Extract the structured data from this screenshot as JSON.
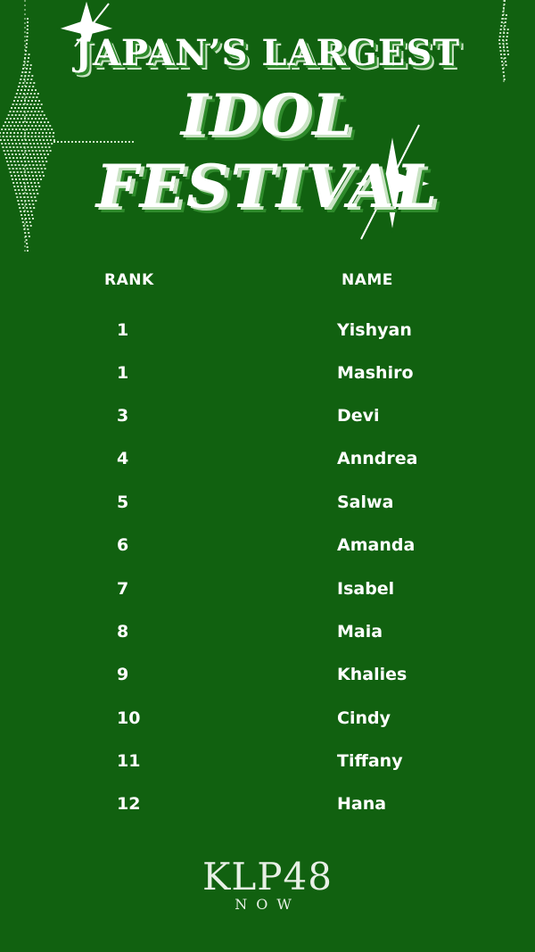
{
  "title": {
    "line1": "JAPAN’S LARGEST",
    "line2": "IDOL",
    "line3": "FESTIVAL"
  },
  "table": {
    "headers": {
      "rank": "RANK",
      "name": "NAME"
    },
    "rows": [
      {
        "rank": "1",
        "name": "Yishyan"
      },
      {
        "rank": "1",
        "name": "Mashiro"
      },
      {
        "rank": "3",
        "name": "Devi"
      },
      {
        "rank": "4",
        "name": "Anndrea"
      },
      {
        "rank": "5",
        "name": "Salwa"
      },
      {
        "rank": "6",
        "name": "Amanda"
      },
      {
        "rank": "7",
        "name": "Isabel"
      },
      {
        "rank": "8",
        "name": "Maia"
      },
      {
        "rank": "9",
        "name": "Khalies"
      },
      {
        "rank": "10",
        "name": "Cindy"
      },
      {
        "rank": "11",
        "name": "Tiffany"
      },
      {
        "rank": "12",
        "name": "Hana"
      }
    ]
  },
  "brand": {
    "name": "KLP48",
    "sub": "NOW"
  },
  "colors": {
    "background": "#116110",
    "text": "#ffffff",
    "accent": "#c8e3c3"
  },
  "icons": [
    "sparkle-star-icon",
    "dotted-chandelier-decoration"
  ]
}
